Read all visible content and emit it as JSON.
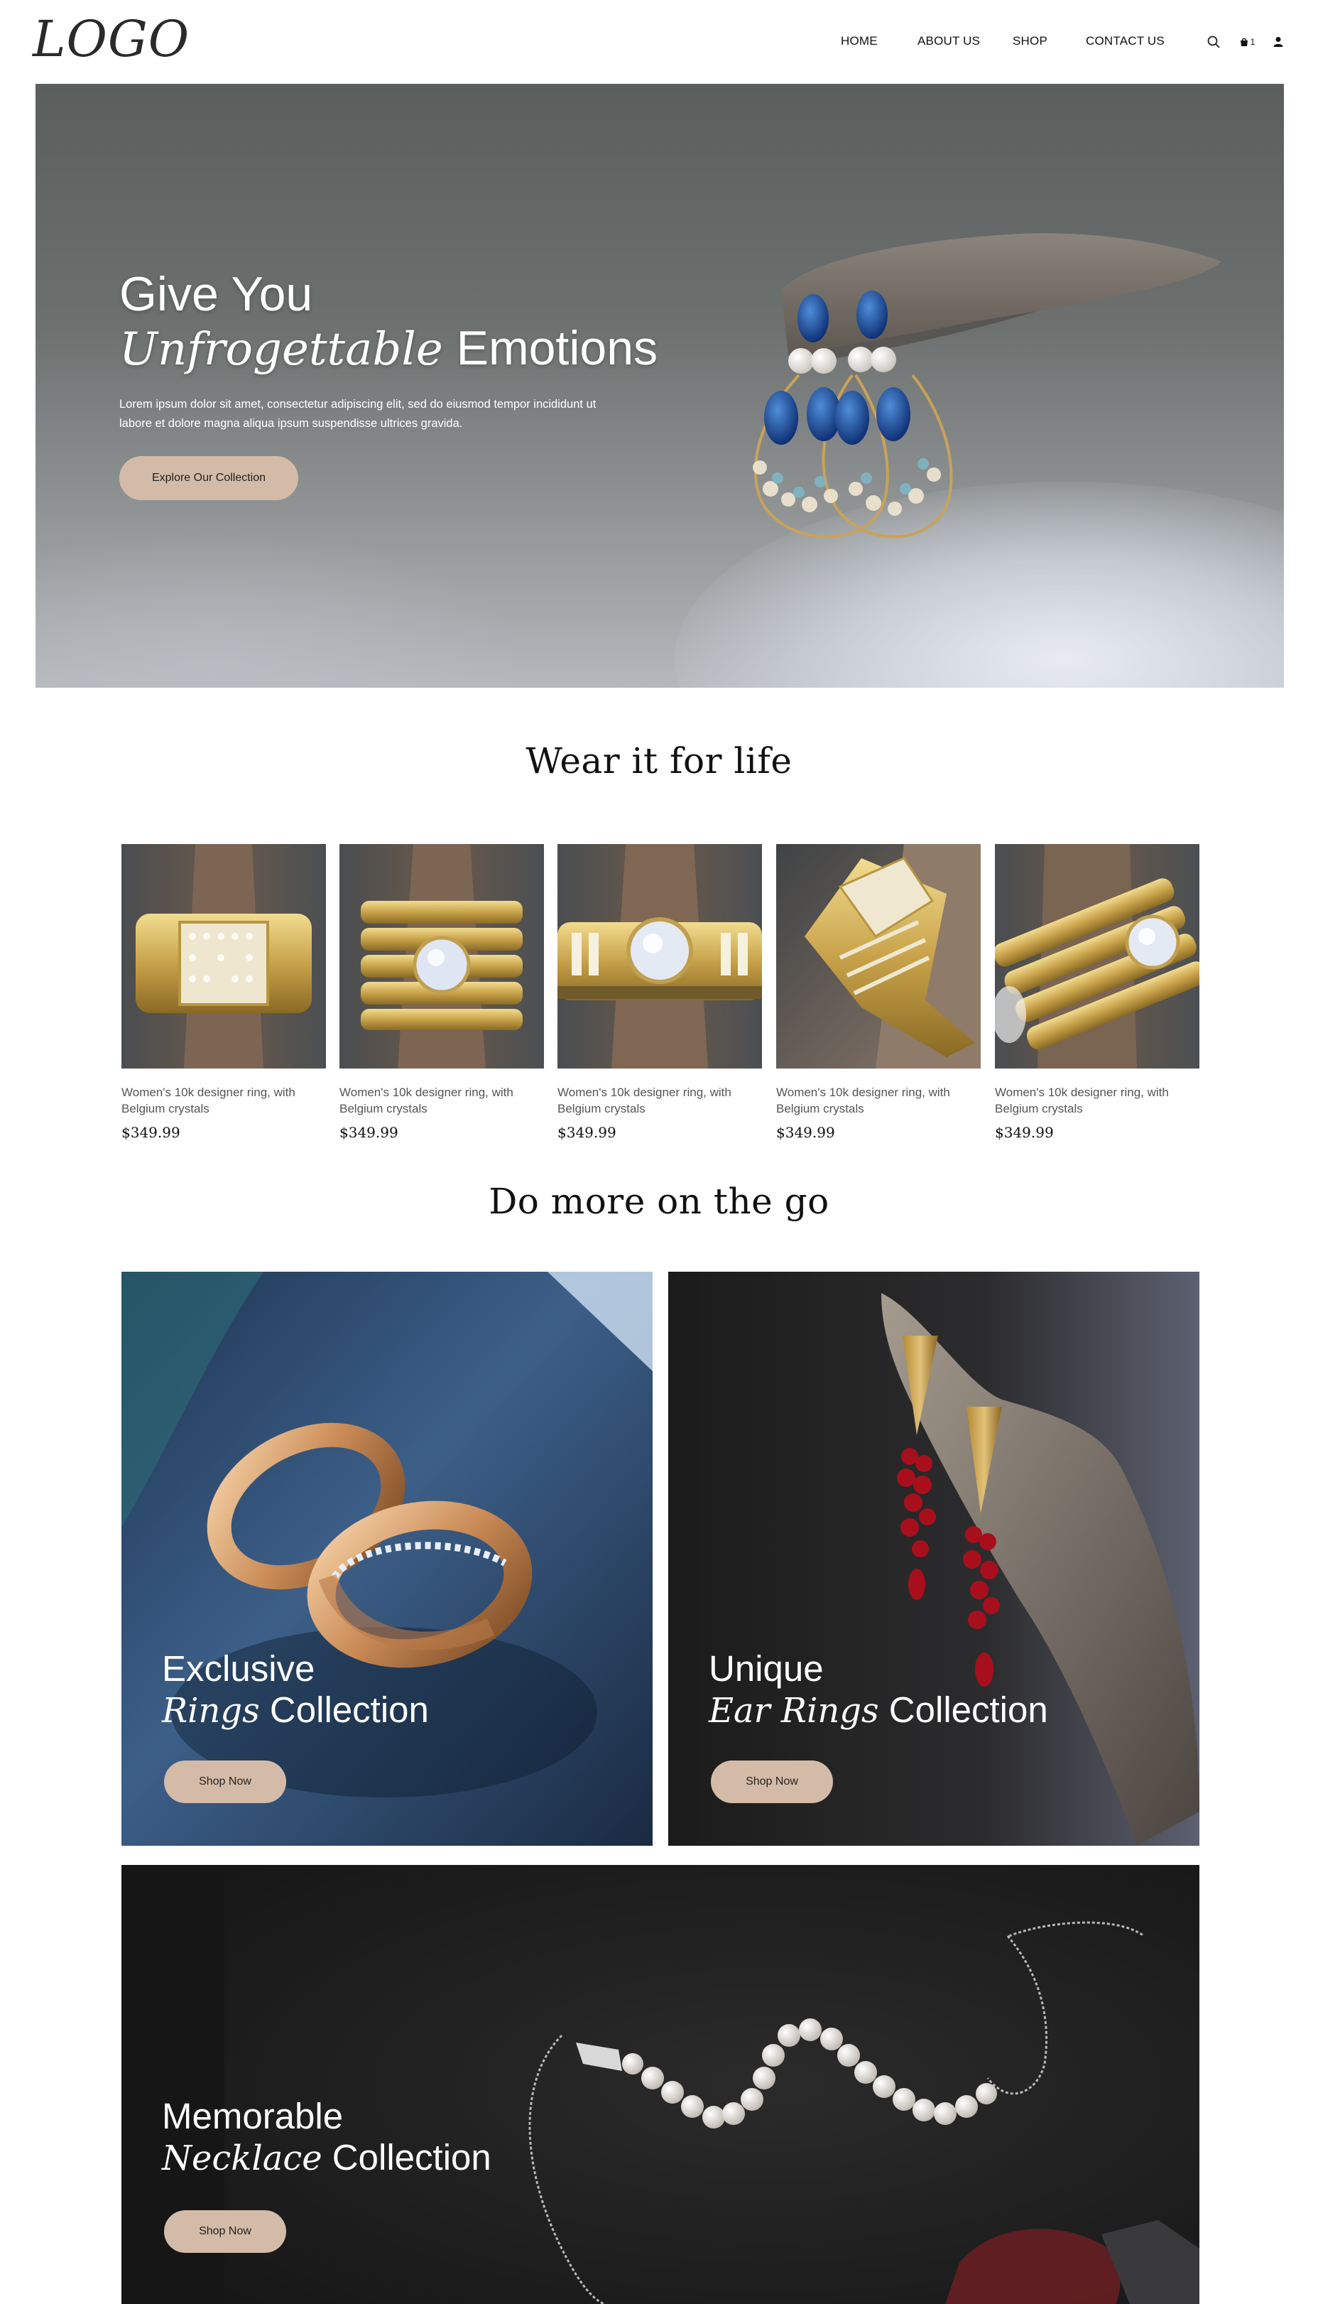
{
  "header": {
    "logo": "LOGO",
    "nav": [
      "HOME",
      "ABOUT US",
      "SHOP",
      "CONTACT US"
    ],
    "cart_count": "1",
    "icons": [
      "search-icon",
      "cart-icon",
      "user-icon"
    ]
  },
  "hero": {
    "title_line1": "Give You",
    "title_em": "Unfrogettable",
    "title_rest": " Emotions",
    "text": "Lorem ipsum dolor sit amet, consectetur adipiscing elit, sed do eiusmod tempor incididunt ut labore et dolore magna aliqua ipsum suspendisse ultrices gravida.",
    "button": "Explore Our Collection"
  },
  "products_section": {
    "title": "Wear it for life",
    "items": [
      {
        "name": "Women's 10k designer ring, with Belgium crystals",
        "price": "$349.99"
      },
      {
        "name": "Women's 10k designer ring, with Belgium crystals",
        "price": "$349.99"
      },
      {
        "name": "Women's 10k designer ring, with Belgium crystals",
        "price": "$349.99"
      },
      {
        "name": "Women's 10k designer ring, with Belgium crystals",
        "price": "$349.99"
      },
      {
        "name": "Women's 10k designer ring, with Belgium crystals",
        "price": "$349.99"
      }
    ]
  },
  "collections_section": {
    "title": "Do more on the go",
    "rings": {
      "line1": "Exclusive",
      "em": "Rings",
      "rest": " Collection",
      "button": "Shop Now"
    },
    "earrings": {
      "line1": "Unique",
      "em": "Ear Rings",
      "rest": " Collection",
      "button": "Shop Now"
    },
    "necklace": {
      "line1": "Memorable",
      "em": "Necklace",
      "rest": " Collection",
      "button": "Shop Now"
    }
  },
  "colors": {
    "accent_button": "#d4bba8",
    "text_dark": "#111111",
    "product_text": "#555555"
  }
}
